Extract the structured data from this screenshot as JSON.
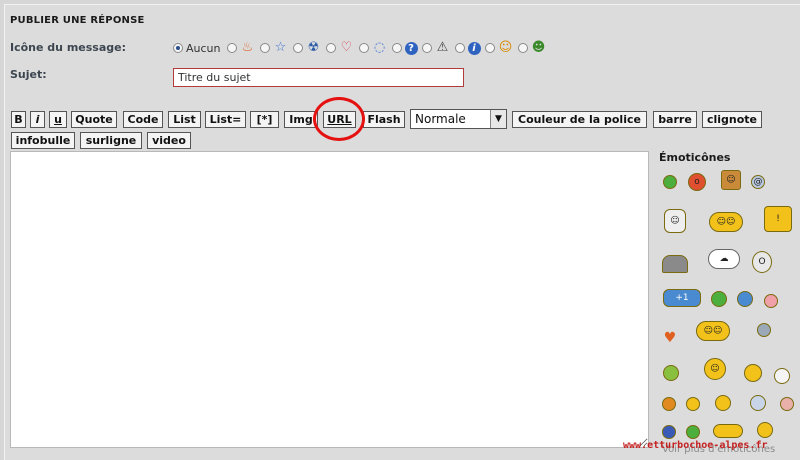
{
  "form": {
    "title": "PUBLIER UNE RÉPONSE",
    "icon_label": "Icône du message:",
    "icon_none": "Aucun",
    "subject_label": "Sujet:",
    "subject_value": "Titre du sujet"
  },
  "message_icons": [
    {
      "name": "none",
      "checked": true
    },
    {
      "name": "fire-icon",
      "glyph": "🔥"
    },
    {
      "name": "star-icon",
      "glyph": "☆"
    },
    {
      "name": "radioactive-icon",
      "glyph": "☢"
    },
    {
      "name": "heart-icon",
      "glyph": "♡"
    },
    {
      "name": "speech-bubble-icon",
      "glyph": "💬"
    },
    {
      "name": "question-icon",
      "glyph": "?"
    },
    {
      "name": "warning-icon",
      "glyph": "⚠"
    },
    {
      "name": "info-icon",
      "glyph": "i"
    },
    {
      "name": "wink-smiley-icon",
      "glyph": "☺"
    },
    {
      "name": "grin-smiley-icon",
      "glyph": "☻"
    }
  ],
  "toolbar": {
    "bold": "B",
    "italic": "i",
    "underline": "u",
    "quote": "Quote",
    "code": "Code",
    "list": "List",
    "list_eq": "List=",
    "item": "[*]",
    "img": "Img",
    "url": "URL",
    "flash": "Flash",
    "size_select": "Normale",
    "font_color": "Couleur de la police",
    "strike": "barre",
    "blink": "clignote",
    "tooltip": "infobulle",
    "highlight": "surligne",
    "video": "video"
  },
  "emoticons": {
    "title": "Émoticônes",
    "more": "Voir plus d'émoticônes"
  },
  "watermark": "www.etturbochoe-alpes.fr",
  "colors": {
    "accent_circle": "#e51010",
    "subject_border": "#b13a3a"
  }
}
